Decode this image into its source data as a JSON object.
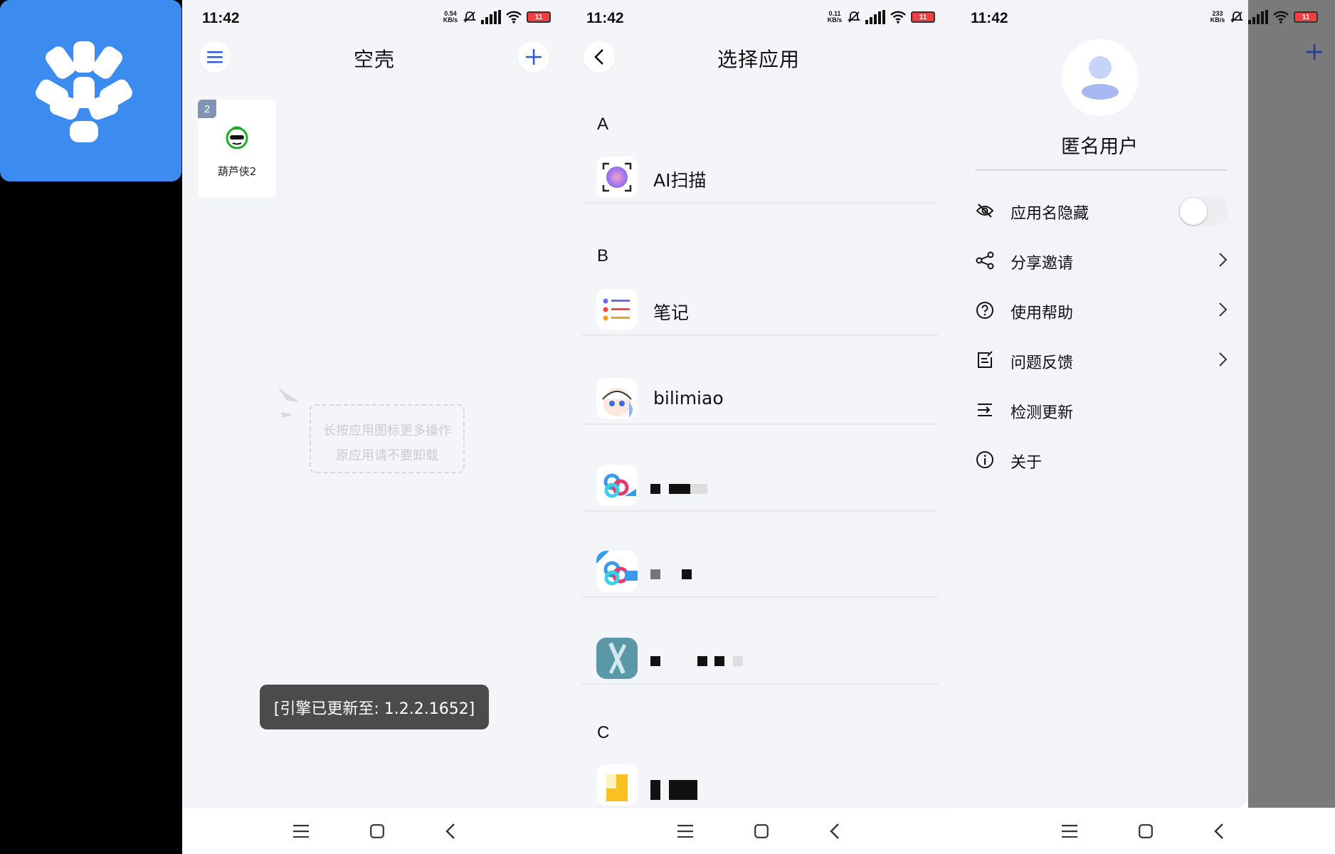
{
  "status_bars": [
    {
      "time": "11:42",
      "speed_value": "0.54",
      "speed_unit": "KB/s",
      "battery": "11"
    },
    {
      "time": "11:42",
      "speed_value": "0.11",
      "speed_unit": "KB/s",
      "battery": "11"
    },
    {
      "time": "11:42",
      "speed_value": "233",
      "speed_unit": "KB/s",
      "battery": "11"
    }
  ],
  "home": {
    "title": "空壳",
    "app": {
      "name": "葫芦侠2",
      "badge": "2"
    },
    "hint_lines": [
      "长按应用图标更多操作",
      "原应用请不要卸载"
    ],
    "toast": "[引擎已更新至: 1.2.2.1652]"
  },
  "picker": {
    "title": "选择应用",
    "sections": [
      {
        "letter": "A",
        "items": [
          "AI扫描"
        ]
      },
      {
        "letter": "B",
        "items": [
          "笔记",
          "bilimiao"
        ]
      },
      {
        "letter": "C",
        "items": []
      }
    ]
  },
  "drawer": {
    "username": "匿名用户",
    "menu": [
      {
        "label": "应用名隐藏",
        "icon": "eye-off-icon",
        "control": "toggle",
        "toggle_on": false
      },
      {
        "label": "分享邀请",
        "icon": "share-icon",
        "control": "chevron"
      },
      {
        "label": "使用帮助",
        "icon": "help-icon",
        "control": "chevron"
      },
      {
        "label": "问题反馈",
        "icon": "feedback-icon",
        "control": "chevron"
      },
      {
        "label": "检测更新",
        "icon": "update-icon",
        "control": "none"
      },
      {
        "label": "关于",
        "icon": "info-icon",
        "control": "none"
      }
    ]
  },
  "colors": {
    "accent": "#3c8cf0",
    "plus_blue": "#2b5fd9",
    "battery": "#f04040",
    "toast_bg": "#4b4b4b"
  }
}
